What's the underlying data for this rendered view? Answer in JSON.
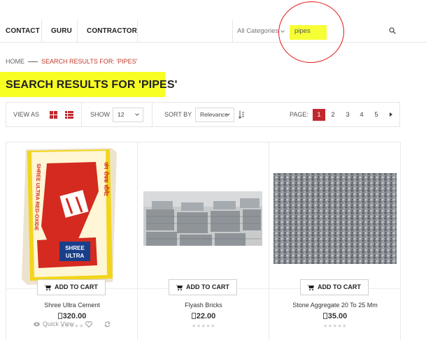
{
  "nav": {
    "items": [
      "CONTACT",
      "GURU",
      "CONTRACTOR"
    ],
    "category_label": "All Categories",
    "search_value": "pipes"
  },
  "breadcrumb": {
    "home": "HOME",
    "current": "SEARCH RESULTS FOR: 'PIPES'"
  },
  "page_title": "SEARCH RESULTS FOR 'PIPES'",
  "toolbar": {
    "view_as_label": "VIEW AS",
    "show_label": "SHOW",
    "show_value": "12",
    "sort_by_label": "SORT BY",
    "sort_value": "Relevance",
    "page_label": "PAGE:",
    "pages": [
      "1",
      "2",
      "3",
      "4",
      "5"
    ],
    "current_page": "1"
  },
  "products": [
    {
      "name": "Shree Ultra Cement",
      "price": "320.00",
      "add_to_cart": "ADD TO CART",
      "quick_view": "Quick View",
      "bag_text": {
        "brand_top": "SHREE",
        "brand_bottom": "ULTRA",
        "side_left": "SHREE ULTRA RED-OXIDE",
        "side_right": "जंग रोधक सीमेंट"
      }
    },
    {
      "name": "Flyash Bricks",
      "price": "22.00",
      "add_to_cart": "ADD TO CART"
    },
    {
      "name": "Stone Aggregate 20 To 25 Mm",
      "price": "35.00",
      "add_to_cart": "ADD TO CART"
    }
  ],
  "colors": {
    "accent_red": "#c0282d",
    "highlight_yellow": "#f7ff22",
    "annotation_red": "#e01818"
  },
  "icons": {
    "search": "search-icon",
    "grid_view": "grid-view-icon",
    "list_view": "list-view-icon",
    "cart": "cart-icon",
    "eye": "eye-icon",
    "heart": "heart-icon",
    "compare": "compare-icon",
    "next": "next-page-icon"
  }
}
